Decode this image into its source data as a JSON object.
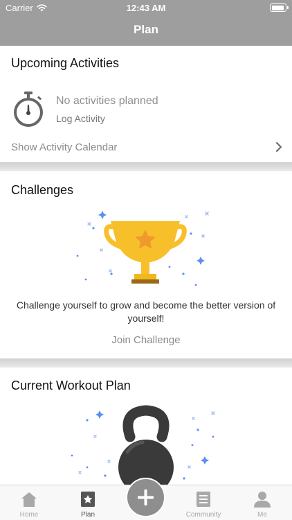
{
  "status_bar": {
    "carrier": "Carrier",
    "time": "12:43 AM"
  },
  "nav": {
    "title": "Plan"
  },
  "upcoming": {
    "title": "Upcoming Activities",
    "empty_text": "No activities planned",
    "log_link": "Log Activity",
    "calendar_link": "Show Activity Calendar"
  },
  "challenges": {
    "title": "Challenges",
    "description": "Challenge yourself to grow and become the better version of yourself!",
    "join_label": "Join Challenge"
  },
  "workout": {
    "title": "Current Workout Plan"
  },
  "tabs": [
    {
      "label": "Home",
      "icon": "home-icon"
    },
    {
      "label": "Plan",
      "icon": "plan-icon",
      "active": true
    },
    {
      "label": "Community",
      "icon": "community-icon"
    },
    {
      "label": "Me",
      "icon": "profile-icon"
    }
  ],
  "colors": {
    "header": "#9e9e9e",
    "trophy": "#f7c02b",
    "trophy_base": "#9a6a1b",
    "sparkle": "#5b8ef0",
    "fab": "#8e8e8e"
  }
}
